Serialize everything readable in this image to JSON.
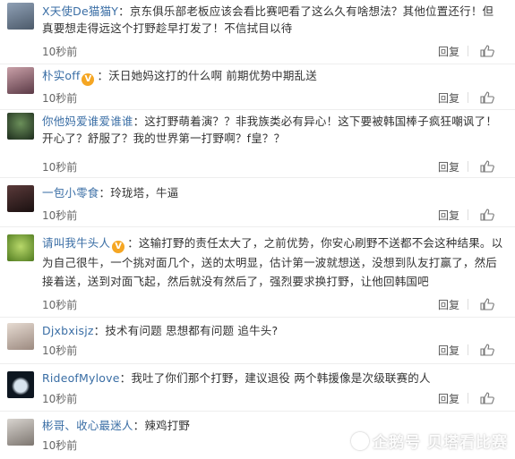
{
  "comments": [
    {
      "user": "X天使De猫猫Y",
      "colon": "：",
      "text": "京东俱乐部老板应该会看比赛吧看了这么久有啥想法？其他位置还行！但真要想走得远这个打野趁早打发了！不信拭目以待",
      "time": "10秒前",
      "reply": "回复",
      "likes": "赞",
      "verified": false,
      "avatar_color": "#6d7f95"
    },
    {
      "user": "朴实off",
      "colon": "：",
      "text": "沃日她妈这打的什么啊 前期优势中期乱送",
      "time": "10秒前",
      "reply": "回复",
      "likes": "赞",
      "verified": true,
      "avatar_color": "#8a5a6b"
    },
    {
      "user": "你他妈爱谁爱谁谁",
      "colon": "：",
      "text": "这打野萌着演？？非我族类必有异心！这下要被韩国棒子疯狂嘲讽了！开心了？舒服了？我的世界第一打野啊？f皇？？",
      "time": "10秒前",
      "reply": "回复",
      "likes": "赞",
      "verified": false,
      "avatar_color": "#2f4a2f"
    },
    {
      "user": "一包小零食",
      "colon": "：",
      "text": "玲珑塔，牛逼",
      "time": "10秒前",
      "reply": "回复",
      "likes": "赞",
      "verified": false,
      "avatar_color": "#3a2a2a"
    },
    {
      "user": "请叫我牛头人",
      "colon": "：",
      "text": "这输打野的责任太大了，之前优势，你安心刷野不送都不会这种结果。以为自己很牛，一个挑对面几个，送的太明显，估计第一波就想送，没想到队友打赢了，然后接着送，送到对面飞起，然后就没有然后了，强烈要求换打野，让他回韩国吧",
      "time": "10秒前",
      "reply": "回复",
      "likes": "赞",
      "verified": true,
      "avatar_color": "#7aa63a"
    },
    {
      "user": "Djxbxisjz",
      "colon": "：",
      "text": "技术有问题 思想都有问题 追牛头?",
      "time": "10秒前",
      "reply": "回复",
      "likes": "赞",
      "verified": false,
      "avatar_color": "#c7b9b0"
    },
    {
      "user": "RideofMylove",
      "colon": "：",
      "text": "我吐了你们那个打野，建议退役 两个韩援像是次级联赛的人",
      "time": "10秒前",
      "reply": "回复",
      "likes": "赞",
      "verified": false,
      "avatar_color": "#1d2a3a"
    },
    {
      "user": "彬哥、收心最迷人",
      "colon": "：",
      "text": "辣鸡打野",
      "time": "10秒前",
      "reply": "回复",
      "likes": "赞",
      "verified": false,
      "avatar_color": "#b4b0aa"
    }
  ],
  "watermark": {
    "text": "企鹅号 贝塔看比赛"
  },
  "colors": {
    "username": "#3a6ea5",
    "verified_badge": "#f5a623"
  }
}
